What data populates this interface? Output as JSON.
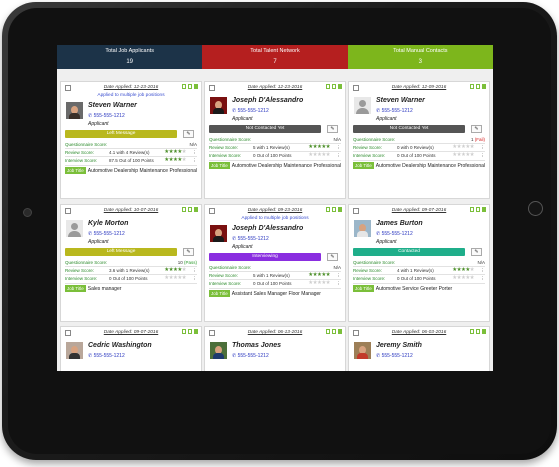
{
  "stats": [
    {
      "label": "Total Job Applicants",
      "value": "19",
      "color": "#1c3348"
    },
    {
      "label": "Total Talent Network",
      "value": "7",
      "color": "#b51f1f"
    },
    {
      "label": "Total Manual Contacts",
      "value": "3",
      "color": "#7db61c"
    }
  ],
  "cards": [
    {
      "date": "Date Applied: 12-23-2016",
      "multi": "Applied to multiple job positions",
      "name": "Steven Warner",
      "phone": "555-555-1212",
      "role": "Applicant",
      "status": "Left Message",
      "status_color": "#b9b81e",
      "q_label": "Questionnaire Score:",
      "q_mid": "",
      "q_right": "N/A",
      "q_note": "",
      "r_label": "Review Score:",
      "r_mid": "4.1 with 4 Review(s)",
      "r_stars": 4,
      "i_label": "Interview Score:",
      "i_mid": "87.5 Out of 100 Points",
      "i_stars": 4,
      "job_tag": "Job Title",
      "job": "Automotive Dealership Maintenance Professional",
      "avatar": "photo1"
    },
    {
      "date": "Date Applied: 12-23-2016",
      "multi": "",
      "name": "Joseph D'Alessandro",
      "phone": "555-555-1212",
      "role": "Applicant",
      "status": "Not Contacted Yet",
      "status_color": "#555555",
      "q_label": "Questionnaire Score:",
      "q_mid": "",
      "q_right": "N/A",
      "q_note": "",
      "r_label": "Review Score:",
      "r_mid": "5 with 1 Review(s)",
      "r_stars": 5,
      "i_label": "Interview Score:",
      "i_mid": "0 Out of 100 Points",
      "i_stars": 0,
      "job_tag": "Job Title",
      "job": "Automotive Dealership Maintenance Professional",
      "avatar": "photo2"
    },
    {
      "date": "Date Applied: 12-09-2016",
      "multi": "",
      "name": "Steven Warner",
      "phone": "555-555-1212",
      "role": "Applicant",
      "status": "Not Contacted Yet",
      "status_color": "#555555",
      "q_label": "Questionnaire Score:",
      "q_mid": "",
      "q_right": "1",
      "q_note": "(Fail)",
      "r_label": "Review Score:",
      "r_mid": "0 with 0 Review(s)",
      "r_stars": 0,
      "i_label": "Interview Score:",
      "i_mid": "0 Out of 100 Points",
      "i_stars": 0,
      "job_tag": "Job Title",
      "job": "Automotive Dealership Maintenance Professional",
      "avatar": "generic"
    },
    {
      "date": "Date Applied: 10-07-2016",
      "multi": "",
      "name": "Kyle Morton",
      "phone": "555-555-1212",
      "role": "Applicant",
      "status": "Left Message",
      "status_color": "#b9b81e",
      "q_label": "Questionnaire Score:",
      "q_mid": "",
      "q_right": "10",
      "q_note": "(Pass)",
      "r_label": "Review Score:",
      "r_mid": "3.6 with 1 Review(s)",
      "r_stars": 4,
      "i_label": "Interview Score:",
      "i_mid": "0 Out of 100 Points",
      "i_stars": 0,
      "job_tag": "Job Title",
      "job": "Sales manager",
      "avatar": "generic"
    },
    {
      "date": "Date Applied: 09-23-2016",
      "multi": "Applied to multiple job positions",
      "name": "Joseph D'Alessandro",
      "phone": "555-555-1212",
      "role": "Applicant",
      "status": "Interviewing",
      "status_color": "#8a2ee0",
      "q_label": "Questionnaire Score:",
      "q_mid": "",
      "q_right": "N/A",
      "q_note": "",
      "r_label": "Review Score:",
      "r_mid": "5 with 1 Review(s)",
      "r_stars": 5,
      "i_label": "Interview Score:",
      "i_mid": "0 Out of 100 Points",
      "i_stars": 0,
      "job_tag": "Job Title",
      "job": "Assistant Sales Manager Floor Manager",
      "avatar": "photo2"
    },
    {
      "date": "Date Applied: 09-07-2016",
      "multi": "",
      "name": "James Burton",
      "phone": "555-555-1212",
      "role": "Applicant",
      "status": "Contacted",
      "status_color": "#1fae8a",
      "q_label": "Questionnaire Score:",
      "q_mid": "",
      "q_right": "N/A",
      "q_note": "",
      "r_label": "Review Score:",
      "r_mid": "4 with 1 Review(s)",
      "r_stars": 4,
      "i_label": "Interview Score:",
      "i_mid": "0 Out of 100 Points",
      "i_stars": 0,
      "job_tag": "Job Title",
      "job": "Automotive Service Greeter Porter",
      "avatar": "photo3"
    },
    {
      "date": "Date Applied: 09-07-2016",
      "multi": "",
      "name": "Cedric Washington",
      "phone": "555-555-1212",
      "role": "",
      "status": "",
      "status_color": "",
      "q_label": "",
      "q_mid": "",
      "q_right": "",
      "q_note": "",
      "r_label": "",
      "r_mid": "",
      "r_stars": -1,
      "i_label": "",
      "i_mid": "",
      "i_stars": -1,
      "job_tag": "",
      "job": "",
      "avatar": "photo4"
    },
    {
      "date": "Date Applied: 06-13-2016",
      "multi": "",
      "name": "Thomas Jones",
      "phone": "555-555-1212",
      "role": "",
      "status": "",
      "status_color": "",
      "q_label": "",
      "q_mid": "",
      "q_right": "",
      "q_note": "",
      "r_label": "",
      "r_mid": "",
      "r_stars": -1,
      "i_label": "",
      "i_mid": "",
      "i_stars": -1,
      "job_tag": "",
      "job": "",
      "avatar": "photo5"
    },
    {
      "date": "Date Applied: 06-03-2016",
      "multi": "",
      "name": "Jeremy Smith",
      "phone": "555-555-1212",
      "role": "",
      "status": "",
      "status_color": "",
      "q_label": "",
      "q_mid": "",
      "q_right": "",
      "q_note": "",
      "r_label": "",
      "r_mid": "",
      "r_stars": -1,
      "i_label": "",
      "i_mid": "",
      "i_stars": -1,
      "job_tag": "",
      "job": "",
      "avatar": "photo6"
    }
  ],
  "icons": {
    "phone": "phone-icon",
    "edit": "pencil-icon",
    "doc": "document-icon",
    "star": "star-icon"
  },
  "pass_color": "#2a9a2a",
  "fail_color": "#d62020"
}
